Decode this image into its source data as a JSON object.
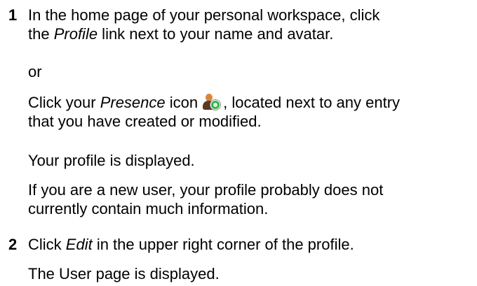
{
  "steps": [
    {
      "number": "1",
      "line1_a": "In the home page of your personal workspace, click",
      "line2_a": "the ",
      "line2_em": "Profile",
      "line2_b": " link next to your name and avatar.",
      "or": "or",
      "click_a": "Click your ",
      "click_em": "Presence",
      "click_b": " icon",
      "click_c": ", located next to any entry",
      "click_line2": "that you have created or modified.",
      "result": "Your profile is displayed.",
      "note_line1": "If you are a new user, your profile probably does not",
      "note_line2": "currently contain much information."
    },
    {
      "number": "2",
      "line1_a": "Click ",
      "line1_em": "Edit",
      "line1_b": " in the upper right corner of the profile.",
      "result": "The User page is displayed."
    }
  ],
  "icons": {
    "presence": "presence-icon"
  }
}
